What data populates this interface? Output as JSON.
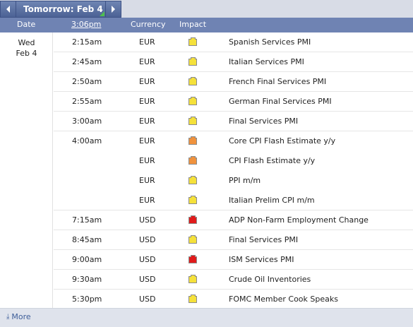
{
  "nav": {
    "title": "Tomorrow: Feb 4"
  },
  "header": {
    "date": "Date",
    "time": "3:06pm",
    "currency": "Currency",
    "impact": "Impact"
  },
  "date": {
    "day": "Wed",
    "date": "Feb 4"
  },
  "impact_colors": {
    "low": "#f5e13a",
    "medium": "#f0923d",
    "high": "#e11b1b"
  },
  "events": [
    {
      "time": "2:15am",
      "currency": "EUR",
      "impact": "low",
      "event": "Spanish Services PMI",
      "sep": true
    },
    {
      "time": "2:45am",
      "currency": "EUR",
      "impact": "low",
      "event": "Italian Services PMI",
      "sep": true
    },
    {
      "time": "2:50am",
      "currency": "EUR",
      "impact": "low",
      "event": "French Final Services PMI",
      "sep": true
    },
    {
      "time": "2:55am",
      "currency": "EUR",
      "impact": "low",
      "event": "German Final Services PMI",
      "sep": true
    },
    {
      "time": "3:00am",
      "currency": "EUR",
      "impact": "low",
      "event": "Final Services PMI",
      "sep": true
    },
    {
      "time": "4:00am",
      "currency": "EUR",
      "impact": "medium",
      "event": "Core CPI Flash Estimate y/y",
      "sep": false
    },
    {
      "time": "",
      "currency": "EUR",
      "impact": "medium",
      "event": "CPI Flash Estimate y/y",
      "sep": false
    },
    {
      "time": "",
      "currency": "EUR",
      "impact": "low",
      "event": "PPI m/m",
      "sep": false
    },
    {
      "time": "",
      "currency": "EUR",
      "impact": "low",
      "event": "Italian Prelim CPI m/m",
      "sep": true
    },
    {
      "time": "7:15am",
      "currency": "USD",
      "impact": "high",
      "event": "ADP Non-Farm Employment Change",
      "sep": true
    },
    {
      "time": "8:45am",
      "currency": "USD",
      "impact": "low",
      "event": "Final Services PMI",
      "sep": true
    },
    {
      "time": "9:00am",
      "currency": "USD",
      "impact": "high",
      "event": "ISM Services PMI",
      "sep": true
    },
    {
      "time": "9:30am",
      "currency": "USD",
      "impact": "low",
      "event": "Crude Oil Inventories",
      "sep": true
    },
    {
      "time": "5:30pm",
      "currency": "USD",
      "impact": "low",
      "event": "FOMC Member Cook Speaks",
      "sep": false
    }
  ],
  "footer": {
    "more": "More",
    "more_icon": "download-arrow-icon"
  }
}
